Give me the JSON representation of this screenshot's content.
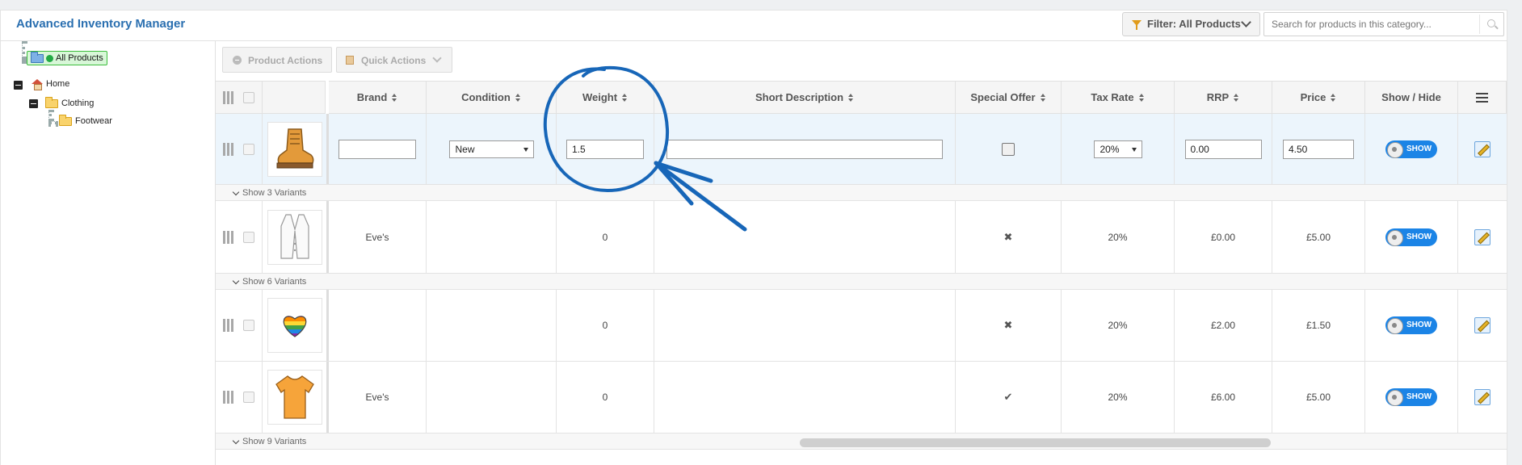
{
  "app": {
    "title": "Advanced Inventory Manager"
  },
  "header": {
    "filter_label": "Filter: All Products",
    "search_placeholder": "Search for products in this category..."
  },
  "tree": {
    "all_products": "All Products",
    "home": "Home",
    "clothing": "Clothing",
    "footwear": "Footwear"
  },
  "toolbar": {
    "product_actions": "Product Actions",
    "quick_actions": "Quick Actions"
  },
  "columns": {
    "brand": "Brand",
    "condition": "Condition",
    "weight": "Weight",
    "short_description": "Short Description",
    "special_offer": "Special Offer",
    "tax_rate": "Tax Rate",
    "rrp": "RRP",
    "price": "Price",
    "show_hide": "Show / Hide"
  },
  "rows": [
    {
      "image": "boot-icon",
      "brand": "",
      "condition": "New",
      "weight": "1.5",
      "short_description": "",
      "special_offer": false,
      "tax_rate": "20%",
      "rrp": "0.00",
      "price": "4.50",
      "toggle": "SHOW",
      "variants": "Show 3 Variants"
    },
    {
      "image": "waistcoat-icon",
      "brand": "Eve's",
      "weight": "0",
      "special_offer": "cross",
      "tax_rate": "20%",
      "rrp": "£0.00",
      "price": "£5.00",
      "toggle": "SHOW",
      "variants": "Show 6 Variants"
    },
    {
      "image": "rainbow-heart-icon",
      "brand": "",
      "weight": "0",
      "special_offer": "cross",
      "tax_rate": "20%",
      "rrp": "£2.00",
      "price": "£1.50",
      "toggle": "SHOW"
    },
    {
      "image": "tshirt-icon",
      "brand": "Eve's",
      "weight": "0",
      "special_offer": "check",
      "tax_rate": "20%",
      "rrp": "£6.00",
      "price": "£5.00",
      "toggle": "SHOW",
      "variants": "Show 9 Variants"
    }
  ],
  "colors": {
    "accent": "#2a6fb0",
    "toggle": "#1b84e6",
    "annotation": "#1766b8"
  }
}
